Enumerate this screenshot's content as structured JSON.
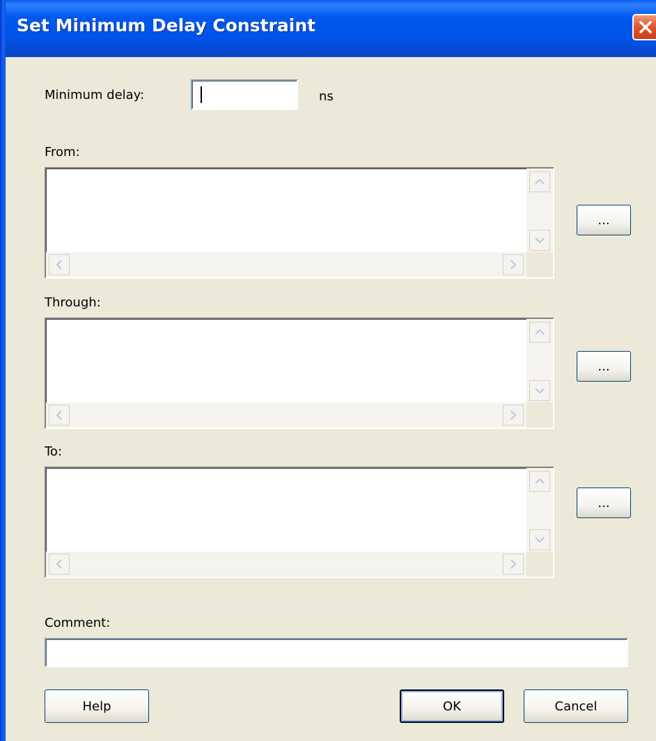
{
  "window": {
    "title": "Set Minimum Delay Constraint"
  },
  "min_delay": {
    "label": "Minimum delay:",
    "value": "",
    "unit": "ns"
  },
  "from": {
    "label": "From:",
    "browse_label": "..."
  },
  "through": {
    "label": "Through:",
    "browse_label": "..."
  },
  "to": {
    "label": "To:",
    "browse_label": "..."
  },
  "comment": {
    "label": "Comment:",
    "value": ""
  },
  "buttons": {
    "help": "Help",
    "ok": "OK",
    "cancel": "Cancel"
  },
  "icons": {
    "close": "close-icon",
    "scroll_up": "scroll-up-arrow-icon",
    "scroll_down": "scroll-down-arrow-icon",
    "scroll_left": "scroll-left-arrow-icon",
    "scroll_right": "scroll-right-arrow-icon"
  },
  "colors": {
    "titlebar": "#0058ee",
    "dialog_bg": "#ece9d8",
    "close_button": "#e2532b"
  }
}
